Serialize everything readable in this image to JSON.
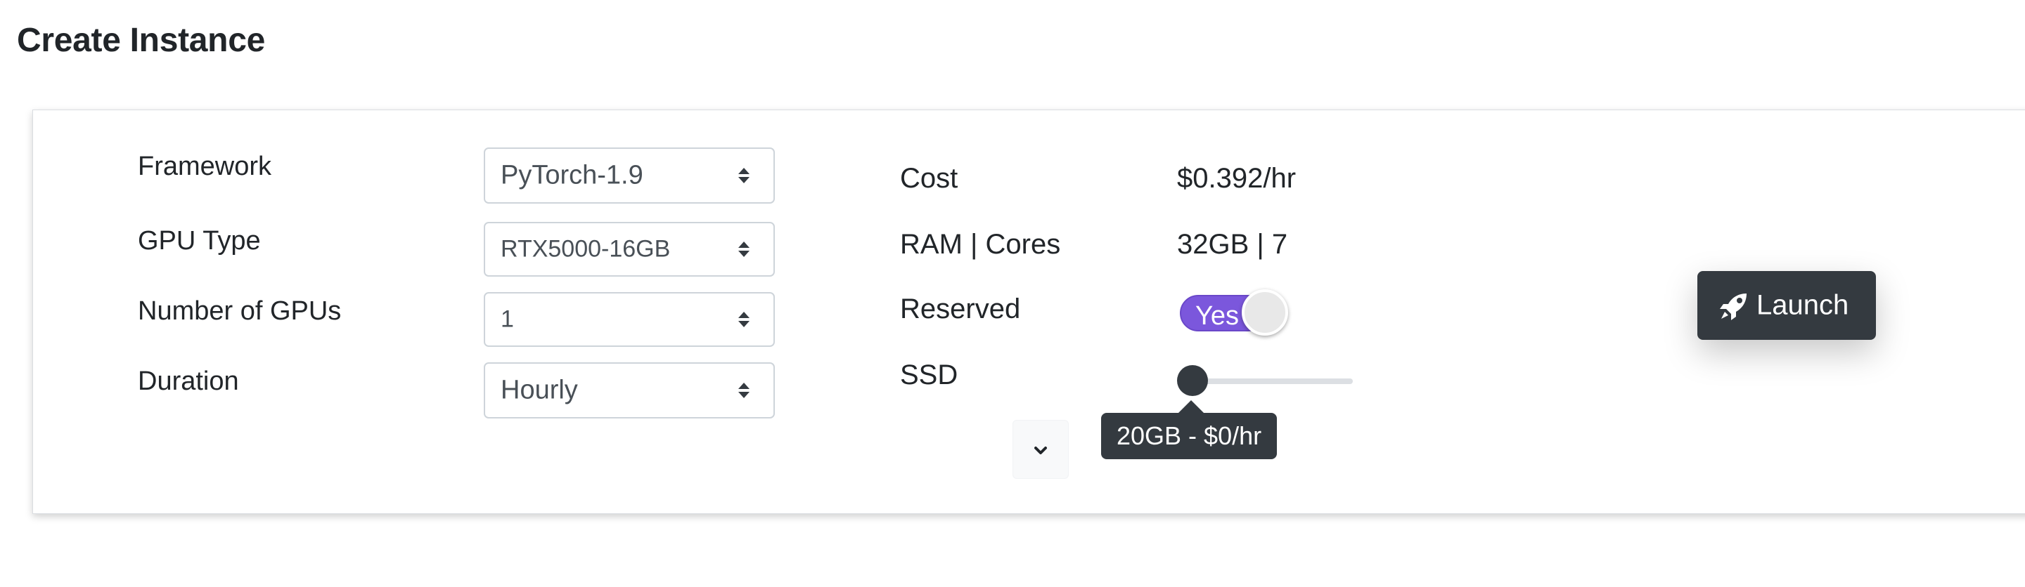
{
  "page": {
    "title": "Create Instance"
  },
  "form": {
    "framework": {
      "label": "Framework",
      "value": "PyTorch-1.9"
    },
    "gpu_type": {
      "label": "GPU Type",
      "value": "RTX5000-16GB"
    },
    "num_gpus": {
      "label": "Number of GPUs",
      "value": "1"
    },
    "duration": {
      "label": "Duration",
      "value": "Hourly"
    }
  },
  "summary": {
    "cost": {
      "label": "Cost",
      "value": "$0.392/hr"
    },
    "ram_cores": {
      "label": "RAM | Cores",
      "value": "32GB | 7"
    },
    "reserved": {
      "label": "Reserved",
      "toggle_text": "Yes",
      "on": true
    },
    "ssd": {
      "label": "SSD",
      "slider_fraction": 0.0,
      "tooltip": "20GB - $0/hr"
    }
  },
  "actions": {
    "launch_label": "Launch",
    "launch_icon": "rocket-icon",
    "expand_icon": "chevron-down-icon"
  },
  "colors": {
    "toggle_on": "#7b57dc",
    "dark": "#343a40",
    "text": "#212529"
  }
}
